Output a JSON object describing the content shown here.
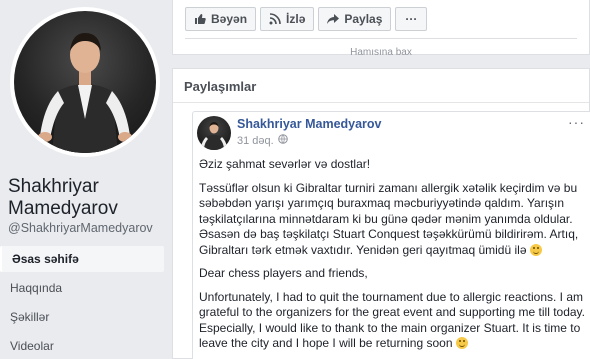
{
  "profile": {
    "name": "Shakhriyar Mamedyarov",
    "handle": "@ShakhriyarMamedyarov"
  },
  "nav": {
    "items": [
      {
        "label": "Əsas səhifə",
        "active": true
      },
      {
        "label": "Haqqında",
        "active": false
      },
      {
        "label": "Şəkillər",
        "active": false
      },
      {
        "label": "Videolar",
        "active": false
      }
    ]
  },
  "actions": {
    "like_label": "Bəyən",
    "follow_label": "İzlə",
    "share_label": "Paylaş",
    "more_label": "···"
  },
  "top_card": {
    "cut_text": "Hamısına bax"
  },
  "shares": {
    "title": "Paylaşımlar"
  },
  "post": {
    "author": "Shakhriyar Mamedyarov",
    "time": "31 dəq.",
    "options_label": "···",
    "greeting": "Əziz şahmat sevərlər və dostlar!",
    "paragraph_az": "Təssüflər olsun ki Gibraltar turniri zamanı allergik xətəlik keçirdim və bu səbəbdən yarışı yarımçıq buraxmaq məcburiyyətində qaldım. Yarışın təşkilatçılarına minnətdaram ki bu günə qədər mənim yanımda oldular. Əsasən də baş təşkilatçı Stuart Conquest təşəkkürümü bildirirəm. Artıq, Gibraltarı tərk etmək vaxtıdır. Yenidən geri qayıtmaq ümidü ilə",
    "greeting_en": "Dear chess players and friends,",
    "paragraph_en": "Unfortunately, I had to quit the tournament due to allergic reactions. I am grateful to the organizers for the great event and supporting me till today. Especially, I would like to thank to the main organizer Stuart. It is time to leave the city and I hope I will be returning soon"
  },
  "colors": {
    "link_blue": "#365899",
    "page_bg": "#e9ebee",
    "emoji_yellow": "#f7c948"
  }
}
